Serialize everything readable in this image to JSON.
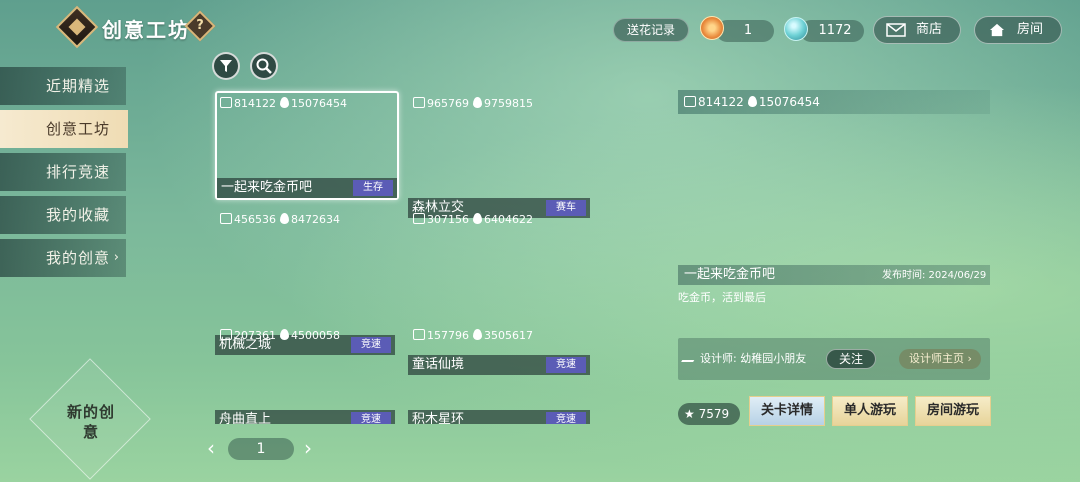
{
  "header": {
    "title": "创意工坊",
    "help_icon": "?",
    "flower_record": "送花记录",
    "flower_count": "1",
    "gem_count": "1172",
    "shop": "商店",
    "room": "房间"
  },
  "sidebar": {
    "items": [
      {
        "label": "近期精选",
        "active": false
      },
      {
        "label": "创意工坊",
        "active": true
      },
      {
        "label": "排行竞速",
        "active": false
      },
      {
        "label": "我的收藏",
        "active": false
      },
      {
        "label": "我的创意",
        "active": false
      }
    ],
    "more_icon": "›",
    "new_creation": "新的创意"
  },
  "cards": [
    {
      "plays": "814122",
      "heat": "15076454",
      "name": "一起来吃金币吧",
      "tag": "生存",
      "selected": true
    },
    {
      "plays": "965769",
      "heat": "9759815",
      "name": "森林立交",
      "tag": "赛车",
      "selected": false
    },
    {
      "plays": "456536",
      "heat": "8472634",
      "name": "机械之城",
      "tag": "竞速",
      "selected": false
    },
    {
      "plays": "307156",
      "heat": "6404622",
      "name": "童话仙境",
      "tag": "竞速",
      "selected": false
    },
    {
      "plays": "207361",
      "heat": "4500058",
      "name": "舟曲直上",
      "tag": "竞速",
      "selected": false
    },
    {
      "plays": "157796",
      "heat": "3505617",
      "name": "积木星环",
      "tag": "竞速",
      "selected": false
    }
  ],
  "pagination": {
    "page": "1",
    "prev": "‹",
    "next": "›"
  },
  "detail": {
    "plays": "814122",
    "heat": "15076454",
    "name": "一起来吃金币吧",
    "publish_date": "发布时间: 2024/06/29",
    "description": "吃金币，活到最后",
    "designer_label": "设计师: 幼稚园小朋友",
    "follow": "关注",
    "designer_home": "设计师主页 ›",
    "likes": "7579",
    "level_details": "关卡详情",
    "solo_play": "单人游玩",
    "room_play": "房间游玩"
  }
}
